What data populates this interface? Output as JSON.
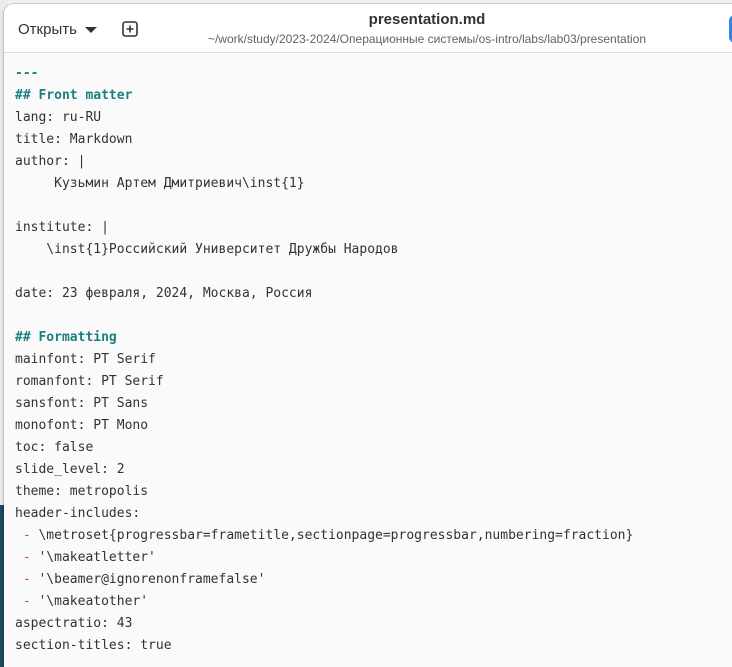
{
  "window": {
    "title": "presentation.md",
    "path": "~/work/study/2023-2024/Операционные системы/os-intro/labs/lab03/presentation"
  },
  "toolbar": {
    "open_label": "Открыть"
  },
  "colors": {
    "heading": "#1a7f7f",
    "list_marker": "#e5461c",
    "text": "#2e3436",
    "accent": "#3584e4",
    "editor_bg": "#fafafa"
  },
  "icons": {
    "open_menu": "chevron-down-icon",
    "new_document": "plus-square-icon"
  },
  "editor": {
    "lines": [
      {
        "kind": "hdr",
        "text": "---"
      },
      {
        "kind": "hdr",
        "text": "## Front matter"
      },
      {
        "kind": "text",
        "text": "lang: ru-RU"
      },
      {
        "kind": "text",
        "text": "title: Markdown"
      },
      {
        "kind": "text",
        "text": "author: |"
      },
      {
        "kind": "text",
        "text": "     Кузьмин Артем Дмитриевич\\inst{1}"
      },
      {
        "kind": "text",
        "text": ""
      },
      {
        "kind": "text",
        "text": "institute: |"
      },
      {
        "kind": "text",
        "text": "    \\inst{1}Российский Университет Дружбы Народов"
      },
      {
        "kind": "text",
        "text": ""
      },
      {
        "kind": "text",
        "text": "date: 23 февраля, 2024, Москва, Россия"
      },
      {
        "kind": "text",
        "text": ""
      },
      {
        "kind": "hdr",
        "text": "## Formatting"
      },
      {
        "kind": "text",
        "text": "mainfont: PT Serif"
      },
      {
        "kind": "text",
        "text": "romanfont: PT Serif"
      },
      {
        "kind": "text",
        "text": "sansfont: PT Sans"
      },
      {
        "kind": "text",
        "text": "monofont: PT Mono"
      },
      {
        "kind": "text",
        "text": "toc: false"
      },
      {
        "kind": "text",
        "text": "slide_level: 2"
      },
      {
        "kind": "text",
        "text": "theme: metropolis"
      },
      {
        "kind": "text",
        "text": "header-includes:"
      },
      {
        "kind": "list",
        "marker": " -",
        "text": " \\metroset{progressbar=frametitle,sectionpage=progressbar,numbering=fraction}"
      },
      {
        "kind": "list",
        "marker": " -",
        "text": " '\\makeatletter'"
      },
      {
        "kind": "list",
        "marker": " -",
        "text": " '\\beamer@ignorenonframefalse'"
      },
      {
        "kind": "list",
        "marker": " -",
        "text": " '\\makeatother'"
      },
      {
        "kind": "text",
        "text": "aspectratio: 43"
      },
      {
        "kind": "text",
        "text": "section-titles: true"
      }
    ]
  }
}
